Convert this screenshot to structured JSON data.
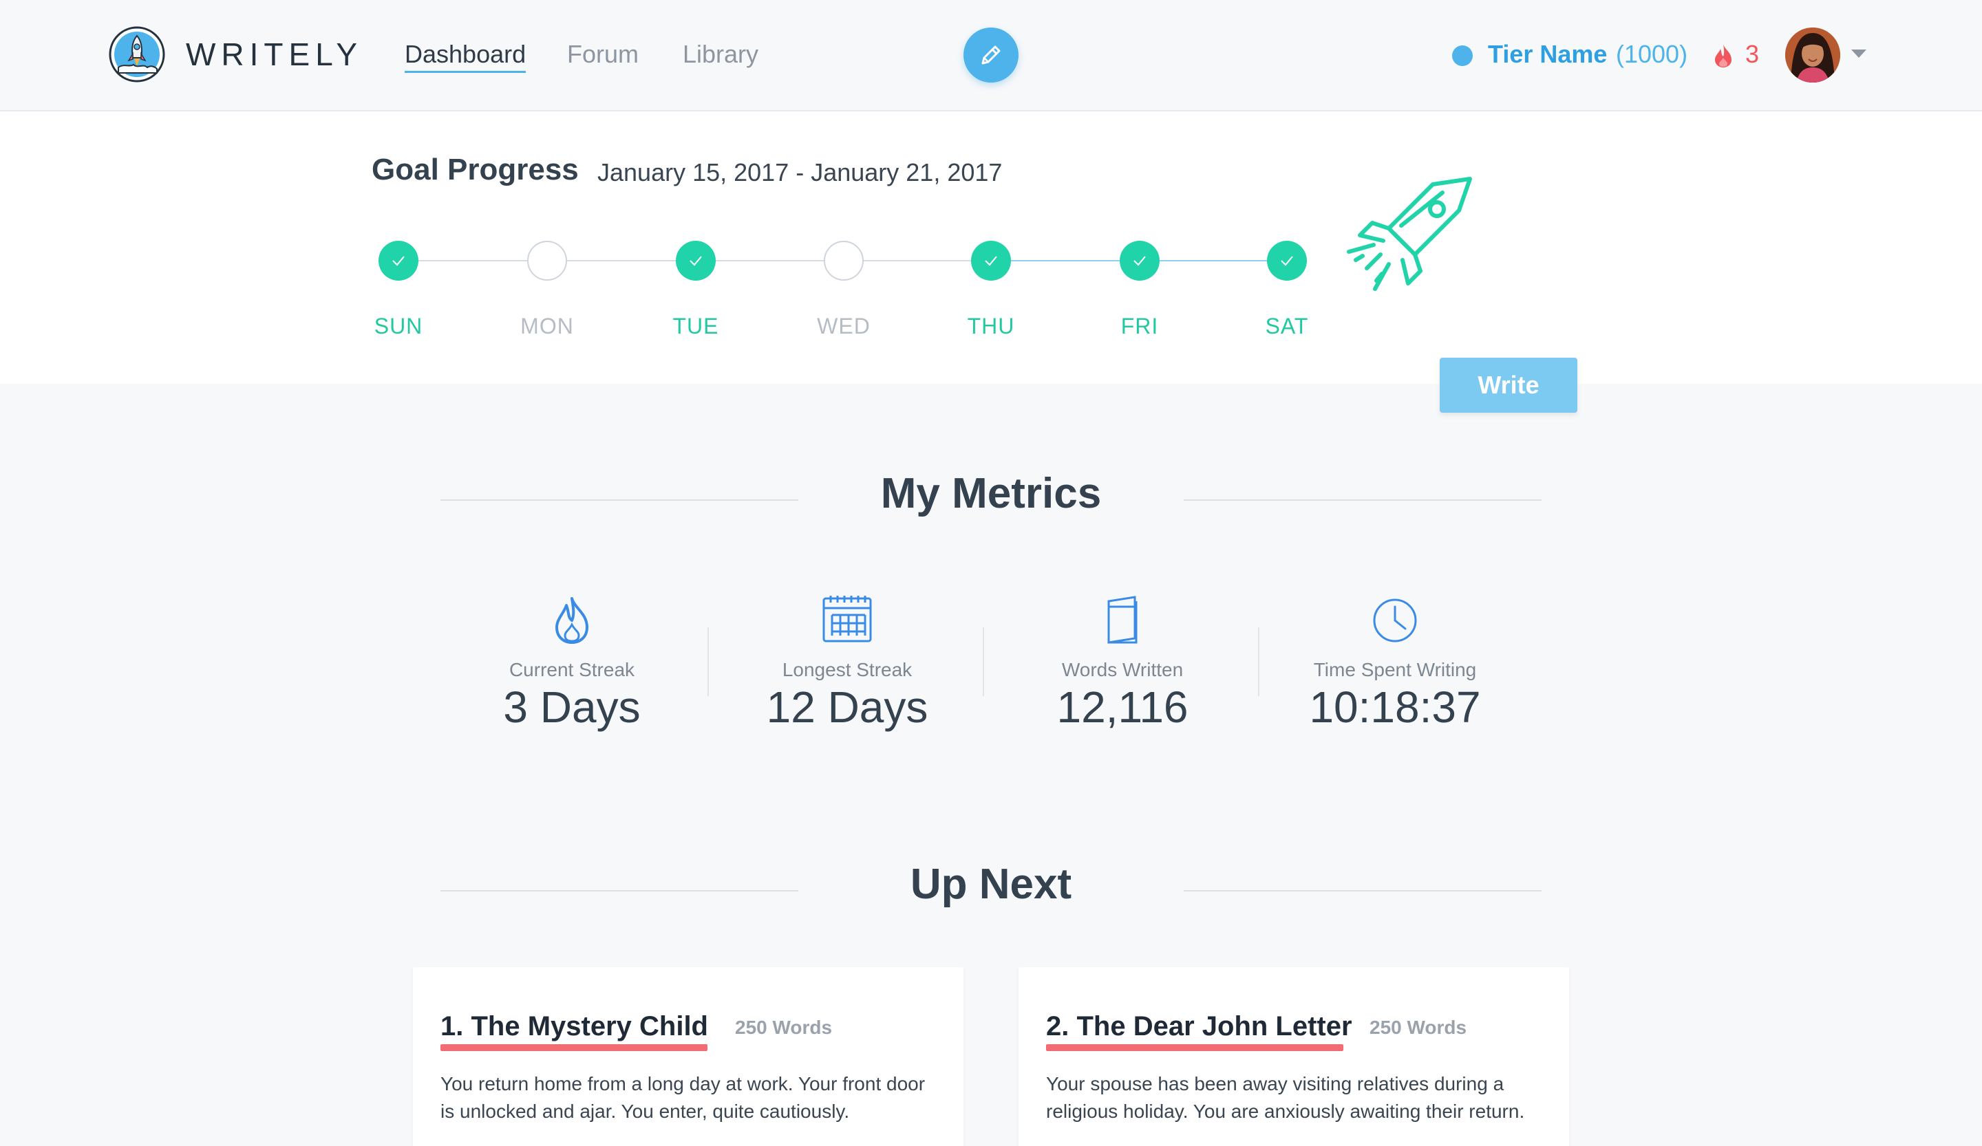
{
  "app": {
    "name": "WRITELY"
  },
  "nav": [
    {
      "label": "Dashboard",
      "active": true
    },
    {
      "label": "Forum",
      "active": false
    },
    {
      "label": "Library",
      "active": false
    }
  ],
  "user": {
    "tier_name": "Tier Name",
    "tier_points": "(1000)",
    "streak_count": "3"
  },
  "goal": {
    "title": "Goal Progress",
    "date_range": "January 15, 2017 - January 21, 2017",
    "days": [
      {
        "label": "SUN",
        "done": true
      },
      {
        "label": "MON",
        "done": false
      },
      {
        "label": "TUE",
        "done": true
      },
      {
        "label": "WED",
        "done": false
      },
      {
        "label": "THU",
        "done": true
      },
      {
        "label": "FRI",
        "done": true
      },
      {
        "label": "SAT",
        "done": true
      }
    ],
    "write_label": "Write"
  },
  "metrics": {
    "title": "My Metrics",
    "items": [
      {
        "icon": "flame-icon",
        "label": "Current Streak",
        "value": "3 Days"
      },
      {
        "icon": "calendar-icon",
        "label": "Longest Streak",
        "value": "12 Days"
      },
      {
        "icon": "book-icon",
        "label": "Words Written",
        "value": "12,116"
      },
      {
        "icon": "clock-icon",
        "label": "Time Spent Writing",
        "value": "10:18:37"
      }
    ]
  },
  "up_next": {
    "title": "Up Next",
    "cards": [
      {
        "title": "1. The Mystery Child",
        "words": "250 Words",
        "body": "You return home from a long day at work. Your front door is unlocked and ajar. You enter, quite cautiously."
      },
      {
        "title": "2. The Dear John Letter",
        "words": "250 Words",
        "body": "Your spouse has been away visiting relatives during a religious holiday. You are anxiously awaiting their return."
      }
    ]
  },
  "colors": {
    "accent_blue": "#4db3ea",
    "done_green": "#20d3a8",
    "flame_red": "#f0565c",
    "underline_red": "#f26d73"
  }
}
